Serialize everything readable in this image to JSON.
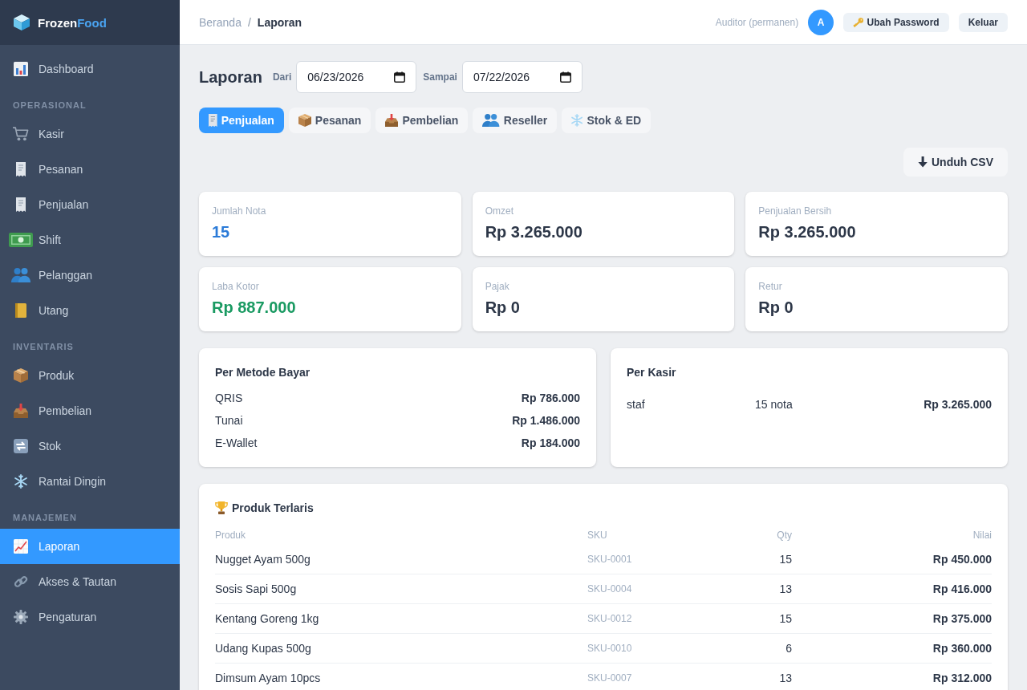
{
  "sidebar": {
    "brand": {
      "name": "Frozen",
      "accent": "Food"
    },
    "sections": [
      {
        "items": [
          {
            "label": "Dashboard",
            "selected": false
          }
        ]
      },
      {
        "heading": "OPERASIONAL",
        "items": [
          {
            "label": "Kasir",
            "selected": false
          },
          {
            "label": "Pesanan",
            "selected": false
          },
          {
            "label": "Penjualan",
            "selected": false
          },
          {
            "label": "Shift",
            "selected": false
          },
          {
            "label": "Pelanggan",
            "selected": false
          },
          {
            "label": "Utang",
            "selected": false
          }
        ]
      },
      {
        "heading": "INVENTARIS",
        "items": [
          {
            "label": "Produk",
            "selected": false
          },
          {
            "label": "Pembelian",
            "selected": false
          },
          {
            "label": "Stok",
            "selected": false
          },
          {
            "label": "Rantai Dingin",
            "selected": false
          }
        ]
      },
      {
        "heading": "MANAJEMEN",
        "items": [
          {
            "label": "Laporan",
            "selected": true
          },
          {
            "label": "Akses & Tautan",
            "selected": false
          },
          {
            "label": "Pengaturan",
            "selected": false
          }
        ]
      }
    ]
  },
  "header": {
    "breadcrumb": {
      "items": [
        "Beranda",
        "Laporan"
      ],
      "separator": "/"
    },
    "user": "Auditor (permanen)",
    "avatar": "A",
    "buttons": [
      "Ubah Password",
      "Keluar"
    ]
  },
  "report": {
    "title": "Laporan",
    "filters": [
      {
        "label": "Dari",
        "value": "06/23/2026"
      },
      {
        "label": "Sampai",
        "value": "07/22/2026"
      }
    ],
    "tabs": [
      {
        "label": "Penjualan",
        "selected": true
      },
      {
        "label": "Pesanan",
        "selected": false
      },
      {
        "label": "Pembelian",
        "selected": false
      },
      {
        "label": "Reseller",
        "selected": false
      },
      {
        "label": "Stok & ED",
        "selected": false
      }
    ],
    "download": "Unduh CSV",
    "stats": [
      {
        "label": "Jumlah Nota",
        "value": "15",
        "color": "#2b7bd8"
      },
      {
        "label": "Omzet",
        "value": "Rp 3.265.000",
        "color": "#2d3748"
      },
      {
        "label": "Penjualan Bersih",
        "value": "Rp 3.265.000",
        "color": "#2d3748"
      },
      {
        "label": "Laba Kotor",
        "value": "Rp 887.000",
        "color": "#1a9a62"
      },
      {
        "label": "Pajak",
        "value": "Rp 0",
        "color": "#2d3748"
      },
      {
        "label": "Retur",
        "value": "Rp 0",
        "color": "#2d3748"
      }
    ],
    "payment_methods": {
      "title": "Per Metode Bayar",
      "rows": [
        {
          "method": "QRIS",
          "amount": "Rp 786.000"
        },
        {
          "method": "Tunai",
          "amount": "Rp 1.486.000"
        },
        {
          "method": "E-Wallet",
          "amount": "Rp 184.000"
        }
      ]
    },
    "cashiers": {
      "title": "Per Kasir",
      "rows": [
        {
          "name": "staf",
          "count": "15 nota",
          "amount": "Rp 3.265.000"
        }
      ]
    },
    "top_products": {
      "title": "Produk Terlaris",
      "columns": [
        "Produk",
        "SKU",
        "Qty",
        "Nilai"
      ],
      "rows": [
        {
          "product": "Nugget Ayam 500g",
          "sku": "SKU-0001",
          "qty": "15",
          "value": "Rp 450.000"
        },
        {
          "product": "Sosis Sapi 500g",
          "sku": "SKU-0004",
          "qty": "13",
          "value": "Rp 416.000"
        },
        {
          "product": "Kentang Goreng 1kg",
          "sku": "SKU-0012",
          "qty": "15",
          "value": "Rp 375.000"
        },
        {
          "product": "Udang Kupas 500g",
          "sku": "SKU-0010",
          "qty": "6",
          "value": "Rp 360.000"
        },
        {
          "product": "Dimsum Ayam 10pcs",
          "sku": "SKU-0007",
          "qty": "13",
          "value": "Rp 312.000"
        }
      ]
    }
  }
}
